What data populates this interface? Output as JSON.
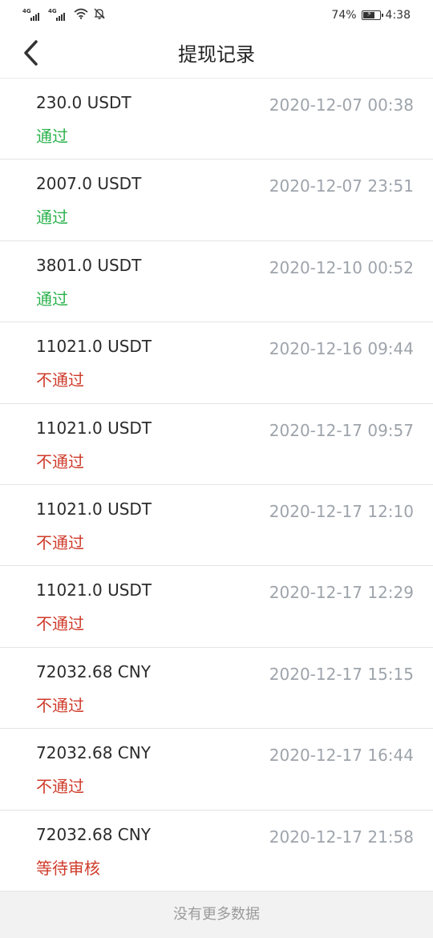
{
  "status_bar": {
    "network_1": "4G",
    "network_2": "4G",
    "battery": "74%",
    "time": "4:38",
    "icons": [
      "signal-icon",
      "signal-icon",
      "wifi-icon",
      "mute-bell-icon",
      "battery-icon"
    ],
    "battery_level": 0.74
  },
  "header": {
    "title": "提现记录",
    "back_icon": "chevron-left-icon"
  },
  "records": [
    {
      "amount": "230.0 USDT",
      "date": "2020-12-07 00:38",
      "status": "通过",
      "kind": "ok"
    },
    {
      "amount": "2007.0 USDT",
      "date": "2020-12-07 23:51",
      "status": "通过",
      "kind": "ok"
    },
    {
      "amount": "3801.0 USDT",
      "date": "2020-12-10 00:52",
      "status": "通过",
      "kind": "ok"
    },
    {
      "amount": "11021.0 USDT",
      "date": "2020-12-16 09:44",
      "status": "不通过",
      "kind": "fail"
    },
    {
      "amount": "11021.0 USDT",
      "date": "2020-12-17 09:57",
      "status": "不通过",
      "kind": "fail"
    },
    {
      "amount": "11021.0 USDT",
      "date": "2020-12-17 12:10",
      "status": "不通过",
      "kind": "fail"
    },
    {
      "amount": "11021.0 USDT",
      "date": "2020-12-17 12:29",
      "status": "不通过",
      "kind": "fail"
    },
    {
      "amount": "72032.68 CNY",
      "date": "2020-12-17 15:15",
      "status": "不通过",
      "kind": "fail"
    },
    {
      "amount": "72032.68 CNY",
      "date": "2020-12-17 16:44",
      "status": "不通过",
      "kind": "fail"
    },
    {
      "amount": "72032.68 CNY",
      "date": "2020-12-17 21:58",
      "status": "等待审核",
      "kind": "pending"
    }
  ],
  "footer": {
    "text": "没有更多数据"
  },
  "colors": {
    "status_ok": "#2bb24c",
    "status_fail": "#cf3b2a",
    "date_text": "#9ea4ab"
  }
}
